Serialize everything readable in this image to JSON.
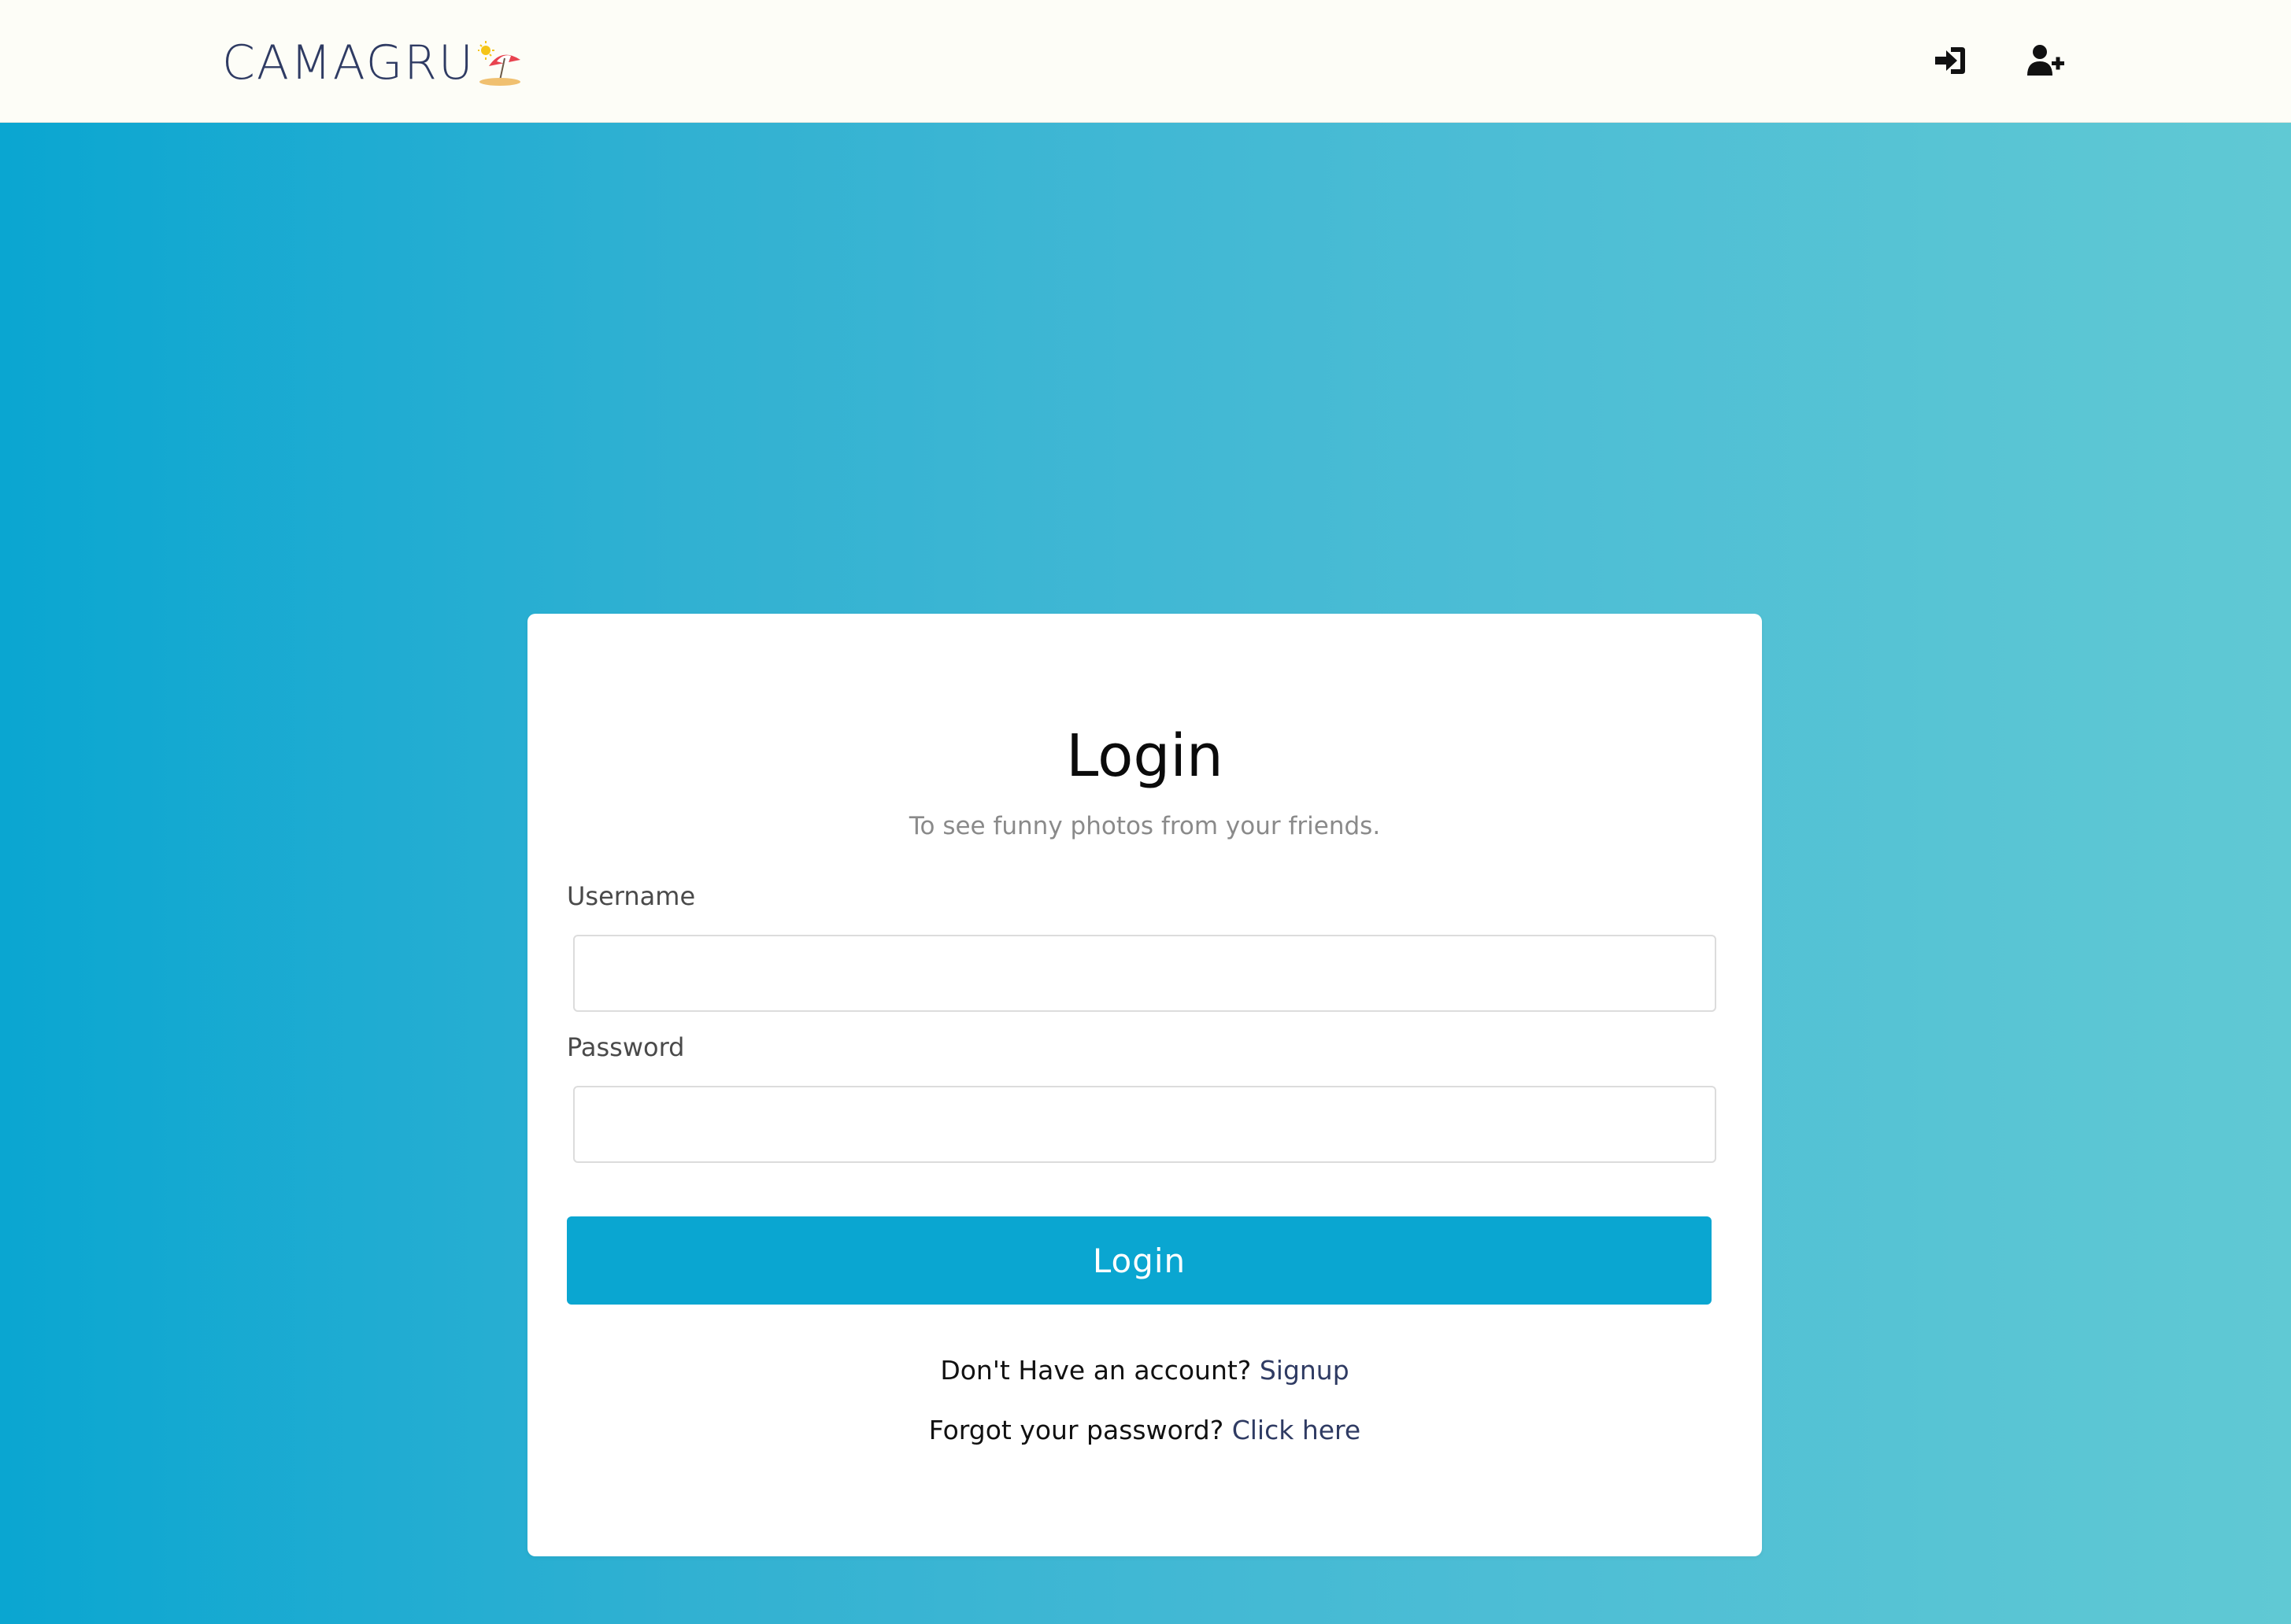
{
  "navbar": {
    "brand": "CAMAGRU",
    "brand_logo_icon": "beach-umbrella-icon",
    "icons": [
      {
        "name": "sign-in-icon"
      },
      {
        "name": "user-plus-icon"
      }
    ]
  },
  "colors": {
    "navbar_bg": "#fdfdf7",
    "brand_text": "#2f3b63",
    "gradient_start": "#0aa6d1",
    "gradient_end": "#60c9d4",
    "button": "#0aa6d1",
    "link": "#2f3b63"
  },
  "login_card": {
    "title": "Login",
    "subtitle": "To see funny photos from your friends.",
    "username_label": "Username",
    "username_value": "",
    "password_label": "Password",
    "password_value": "",
    "submit_label": "Login",
    "signup_prompt": "Don't Have an account?",
    "signup_link": "Signup",
    "forgot_prompt": "Forgot your password?",
    "forgot_link": "Click here"
  }
}
